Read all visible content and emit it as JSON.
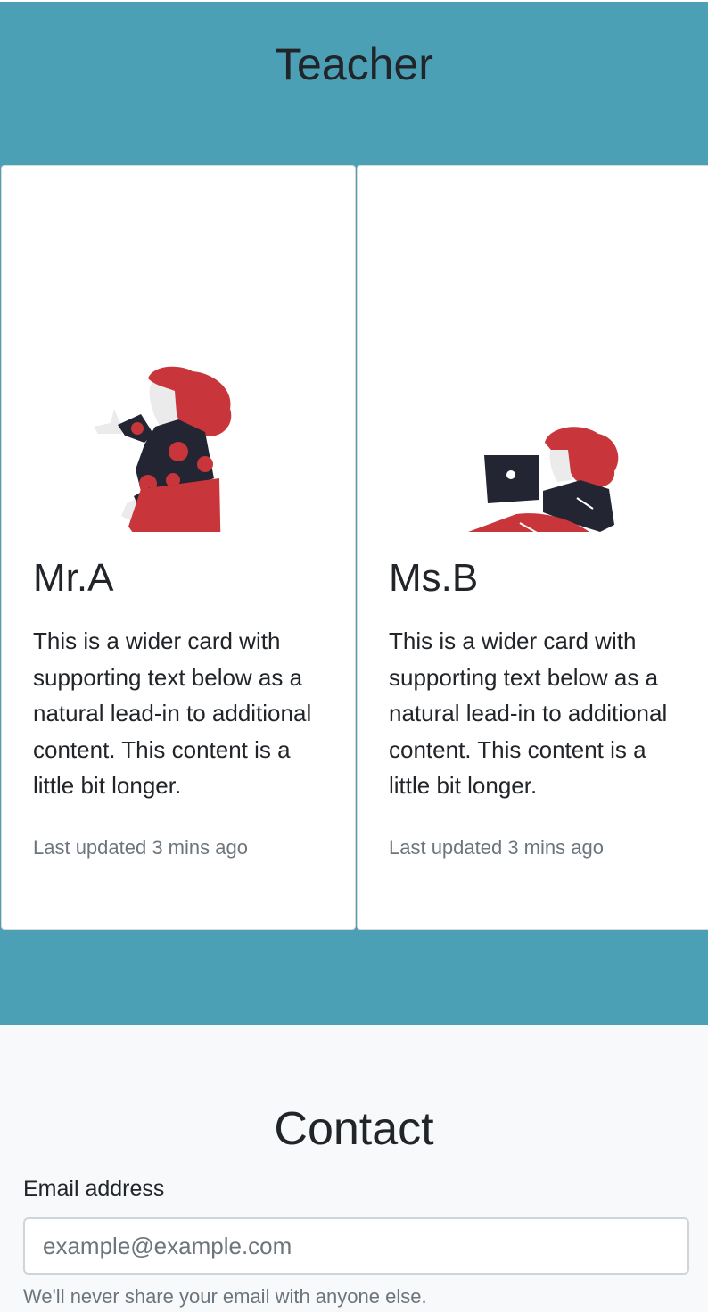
{
  "teacher_section": {
    "title": "Teacher",
    "cards": [
      {
        "illustration": "woman-dancing-illustration",
        "name": "Mr.A",
        "text": "This is a wider card with supporting text below as a natural lead-in to additional content. This content is a little bit longer.",
        "meta": "Last updated 3 mins ago"
      },
      {
        "illustration": "woman-with-laptop-illustration",
        "name": "Ms.B",
        "text": "This is a wider card with supporting text below as a natural lead-in to additional content. This content is a little bit longer.",
        "meta": "Last updated 3 mins ago"
      }
    ]
  },
  "contact_section": {
    "title": "Contact",
    "email_label": "Email address",
    "email_value": "",
    "email_placeholder": "example@example.com",
    "email_help": "We'll never share your email with anyone else."
  },
  "colors": {
    "section_bg": "#4ba0b6",
    "page_bg": "#f8f9fa",
    "illustration_red": "#c8353a",
    "illustration_dark": "#232632"
  }
}
